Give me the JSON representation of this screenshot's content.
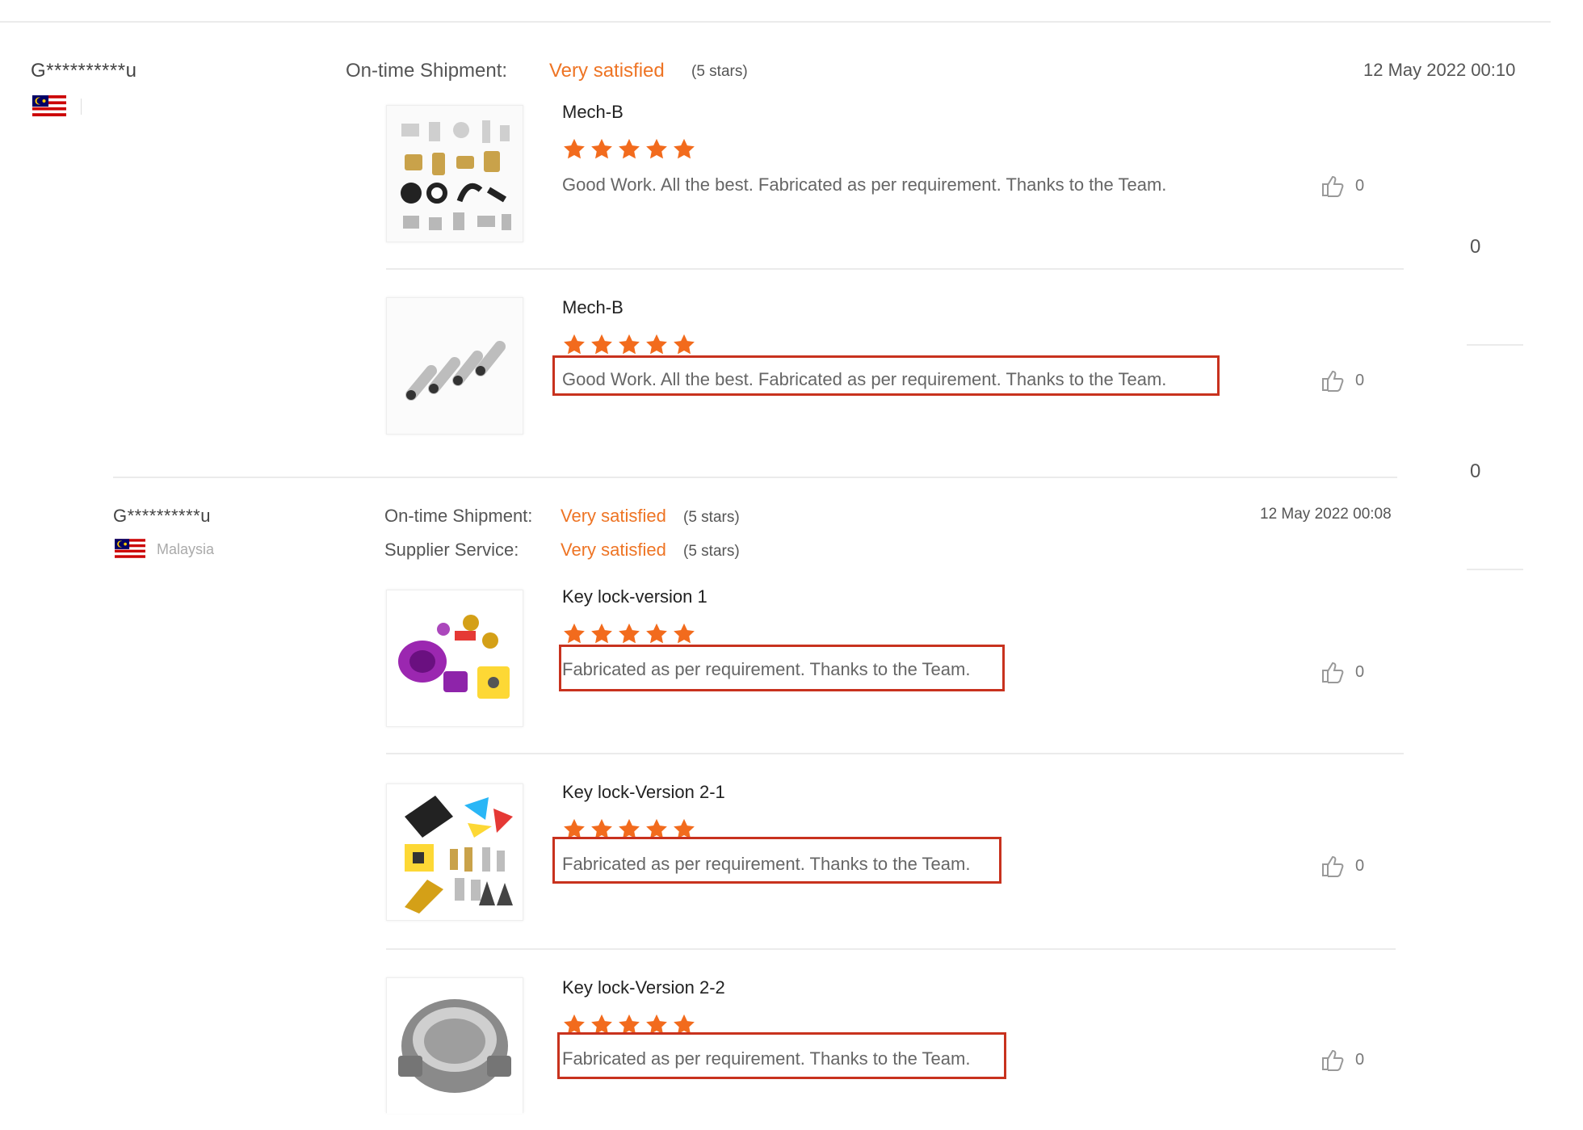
{
  "reviews": [
    {
      "user": "G**********u",
      "country": "",
      "date": "12 May 2022 00:10",
      "ratings": [
        {
          "label": "On-time Shipment:",
          "value": "Very satisfied",
          "stars": "(5 stars)"
        }
      ],
      "items": [
        {
          "product": "Mech-B",
          "rating": 5,
          "text": "Good Work. All the best. Fabricated as per requirement. Thanks to the Team.",
          "likes": "0",
          "icon": "mechanical-parts-photo"
        },
        {
          "product": "Mech-B",
          "rating": 5,
          "text": "Good Work. All the best. Fabricated as per requirement. Thanks to the Team.",
          "likes": "0",
          "icon": "rods-photo"
        }
      ]
    },
    {
      "user": "G**********u",
      "country": "Malaysia",
      "date": "12 May 2022 00:08",
      "ratings": [
        {
          "label": "On-time Shipment:",
          "value": "Very satisfied",
          "stars": "(5 stars)"
        },
        {
          "label": "Supplier Service:",
          "value": "Very satisfied",
          "stars": "(5 stars)"
        }
      ],
      "items": [
        {
          "product": "Key lock-version 1",
          "rating": 5,
          "text": "Fabricated as per requirement. Thanks to the Team.",
          "likes": "0",
          "icon": "purple-parts-photo"
        },
        {
          "product": "Key lock-Version 2-1",
          "rating": 5,
          "text": "Fabricated as per requirement. Thanks to the Team.",
          "likes": "0",
          "icon": "assorted-parts-photo"
        },
        {
          "product": "Key lock-Version 2-2",
          "rating": 5,
          "text": "Fabricated as per requirement. Thanks to the Team.",
          "likes": "0",
          "icon": "housing-photo"
        }
      ]
    }
  ],
  "side_counts": [
    "0",
    "0"
  ],
  "colors": {
    "accent": "#ee7424",
    "highlight": "#c8321e",
    "star": "#f26b1d"
  }
}
